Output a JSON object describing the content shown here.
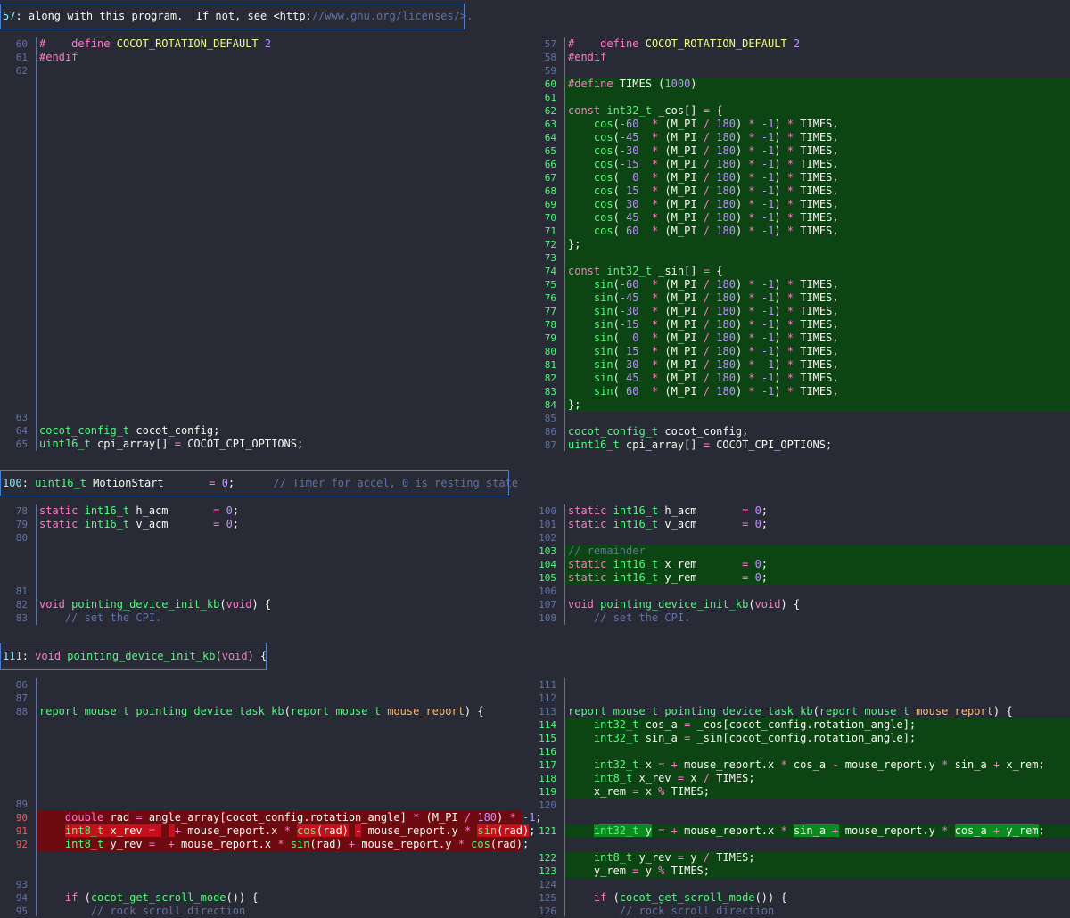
{
  "headers": [
    {
      "top": 0,
      "num": "57",
      "text": "along with this program.  If not, see <http://www.gnu.org/licenses/>."
    },
    {
      "top": 0,
      "num": "100",
      "text": "uint16_t MotionStart       = 0;      // Timer for accel, 0 is resting state"
    },
    {
      "top": 0,
      "num": "111",
      "text": "void pointing_device_init_kb(void) {"
    }
  ],
  "header_texts": {
    "h1": "57: along with this program.  If not, see <http://www.gnu.org/licenses/>.",
    "h2": "100: uint16_t MotionStart       = 0;      // Timer for accel, 0 is resting state",
    "h3": "111: void pointing_device_init_kb(void) {"
  },
  "hunk1": {
    "left": [
      {
        "n": "60",
        "t": "#    define COCOT_ROTATION_DEFAULT 2"
      },
      {
        "n": "61",
        "t": "#endif"
      },
      {
        "n": "62",
        "t": ""
      },
      {
        "n": "63",
        "t": ""
      },
      {
        "n": "64",
        "t": "cocot_config_t cocot_config;"
      },
      {
        "n": "65",
        "t": "uint16_t cpi_array[] = COCOT_CPI_OPTIONS;"
      }
    ],
    "right": [
      {
        "n": "57",
        "t": "#    define COCOT_ROTATION_DEFAULT 2"
      },
      {
        "n": "58",
        "t": "#endif"
      },
      {
        "n": "59",
        "t": ""
      },
      {
        "n": "60",
        "t": "#define TIMES (1000)"
      },
      {
        "n": "61",
        "t": ""
      },
      {
        "n": "62",
        "t": "const int32_t _cos[] = {"
      },
      {
        "n": "63",
        "t": "    cos(-60  * (M_PI / 180) * -1) * TIMES,"
      },
      {
        "n": "64",
        "t": "    cos(-45  * (M_PI / 180) * -1) * TIMES,"
      },
      {
        "n": "65",
        "t": "    cos(-30  * (M_PI / 180) * -1) * TIMES,"
      },
      {
        "n": "66",
        "t": "    cos(-15  * (M_PI / 180) * -1) * TIMES,"
      },
      {
        "n": "67",
        "t": "    cos(  0  * (M_PI / 180) * -1) * TIMES,"
      },
      {
        "n": "68",
        "t": "    cos( 15  * (M_PI / 180) * -1) * TIMES,"
      },
      {
        "n": "69",
        "t": "    cos( 30  * (M_PI / 180) * -1) * TIMES,"
      },
      {
        "n": "70",
        "t": "    cos( 45  * (M_PI / 180) * -1) * TIMES,"
      },
      {
        "n": "71",
        "t": "    cos( 60  * (M_PI / 180) * -1) * TIMES,"
      },
      {
        "n": "72",
        "t": "};"
      },
      {
        "n": "73",
        "t": ""
      },
      {
        "n": "74",
        "t": "const int32_t _sin[] = {"
      },
      {
        "n": "75",
        "t": "    sin(-60  * (M_PI / 180) * -1) * TIMES,"
      },
      {
        "n": "76",
        "t": "    sin(-45  * (M_PI / 180) * -1) * TIMES,"
      },
      {
        "n": "77",
        "t": "    sin(-30  * (M_PI / 180) * -1) * TIMES,"
      },
      {
        "n": "78",
        "t": "    sin(-15  * (M_PI / 180) * -1) * TIMES,"
      },
      {
        "n": "79",
        "t": "    sin(  0  * (M_PI / 180) * -1) * TIMES,"
      },
      {
        "n": "80",
        "t": "    sin( 15  * (M_PI / 180) * -1) * TIMES,"
      },
      {
        "n": "81",
        "t": "    sin( 30  * (M_PI / 180) * -1) * TIMES,"
      },
      {
        "n": "82",
        "t": "    sin( 45  * (M_PI / 180) * -1) * TIMES,"
      },
      {
        "n": "83",
        "t": "    sin( 60  * (M_PI / 180) * -1) * TIMES,"
      },
      {
        "n": "84",
        "t": "};"
      },
      {
        "n": "85",
        "t": ""
      },
      {
        "n": "86",
        "t": "cocot_config_t cocot_config;"
      },
      {
        "n": "87",
        "t": "uint16_t cpi_array[] = COCOT_CPI_OPTIONS;"
      }
    ]
  },
  "hunk2": {
    "left": [
      {
        "n": "78",
        "t": "static int16_t h_acm       = 0;"
      },
      {
        "n": "79",
        "t": "static int16_t v_acm       = 0;"
      },
      {
        "n": "80",
        "t": ""
      },
      {
        "n": "81",
        "t": ""
      },
      {
        "n": "82",
        "t": "void pointing_device_init_kb(void) {"
      },
      {
        "n": "83",
        "t": "    // set the CPI."
      }
    ],
    "right": [
      {
        "n": "100",
        "t": "static int16_t h_acm       = 0;"
      },
      {
        "n": "101",
        "t": "static int16_t v_acm       = 0;"
      },
      {
        "n": "102",
        "t": ""
      },
      {
        "n": "103",
        "t": "// remainder"
      },
      {
        "n": "104",
        "t": "static int16_t x_rem       = 0;"
      },
      {
        "n": "105",
        "t": "static int16_t y_rem       = 0;"
      },
      {
        "n": "106",
        "t": ""
      },
      {
        "n": "107",
        "t": "void pointing_device_init_kb(void) {"
      },
      {
        "n": "108",
        "t": "    // set the CPI."
      }
    ]
  },
  "hunk3": {
    "left": [
      {
        "n": "86",
        "t": ""
      },
      {
        "n": "87",
        "t": ""
      },
      {
        "n": "88",
        "t": "report_mouse_t pointing_device_task_kb(report_mouse_t mouse_report) {"
      },
      {
        "n": "89",
        "t": ""
      },
      {
        "n": "90",
        "t": "    double rad = angle_array[cocot_config.rotation_angle] * (M_PI / 180) * -1;"
      },
      {
        "n": "91",
        "t": "    int8_t x_rev =  + mouse_report.x * cos(rad) - mouse_report.y * sin(rad);"
      },
      {
        "n": "92",
        "t": "    int8_t y_rev =  + mouse_report.x * sin(rad) + mouse_report.y * cos(rad);"
      },
      {
        "n": "93",
        "t": ""
      },
      {
        "n": "94",
        "t": "    if (cocot_get_scroll_mode()) {"
      },
      {
        "n": "95",
        "t": "        // rock scroll direction"
      }
    ],
    "right": [
      {
        "n": "111",
        "t": ""
      },
      {
        "n": "112",
        "t": ""
      },
      {
        "n": "113",
        "t": "report_mouse_t pointing_device_task_kb(report_mouse_t mouse_report) {"
      },
      {
        "n": "114",
        "t": "    int32_t cos_a = _cos[cocot_config.rotation_angle];"
      },
      {
        "n": "115",
        "t": "    int32_t sin_a = _sin[cocot_config.rotation_angle];"
      },
      {
        "n": "116",
        "t": ""
      },
      {
        "n": "117",
        "t": "    int32_t x = + mouse_report.x * cos_a - mouse_report.y * sin_a + x_rem;"
      },
      {
        "n": "118",
        "t": "    int8_t x_rev = x / TIMES;"
      },
      {
        "n": "119",
        "t": "    x_rem = x % TIMES;"
      },
      {
        "n": "120",
        "t": ""
      },
      {
        "n": "121",
        "t": "    int32_t y = + mouse_report.x * sin_a + mouse_report.y * cos_a + y_rem;"
      },
      {
        "n": "122",
        "t": "    int8_t y_rev = y / TIMES;"
      },
      {
        "n": "123",
        "t": "    y_rem = y % TIMES;"
      },
      {
        "n": "124",
        "t": ""
      },
      {
        "n": "125",
        "t": "    if (cocot_get_scroll_mode()) {"
      },
      {
        "n": "126",
        "t": "        // rock scroll direction"
      }
    ]
  },
  "colors": {
    "background": "#282a36",
    "added_bg": "#0c4414",
    "removed_bg": "#6e0b10",
    "removed_hl": "#c4101a",
    "added_hl": "#0b8a1e",
    "header_border": "#4d7fc8"
  }
}
